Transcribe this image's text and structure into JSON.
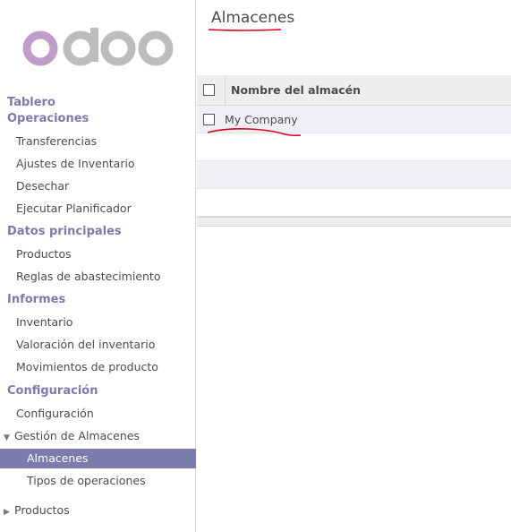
{
  "brand": {
    "logo_text": "odoo"
  },
  "sidebar": {
    "sections": [
      {
        "label": "Tablero",
        "items": []
      },
      {
        "label": "Operaciones",
        "items": [
          "Transferencias",
          "Ajustes de Inventario",
          "Desechar",
          "Ejecutar Planificador"
        ]
      },
      {
        "label": "Datos principales",
        "items": [
          "Productos",
          "Reglas de abastecimiento"
        ]
      },
      {
        "label": "Informes",
        "items": [
          "Inventario",
          "Valoración del inventario",
          "Movimientos de producto"
        ]
      },
      {
        "label": "Configuración",
        "items": [
          "Configuración",
          "Gestión de Almacenes",
          "Almacenes",
          "Tipos de operaciones",
          "Productos"
        ]
      }
    ]
  },
  "main": {
    "title": "Almacenes",
    "table": {
      "columns": [
        "Nombre del almacén"
      ],
      "rows": [
        "My Company"
      ]
    }
  },
  "colors": {
    "accent": "#7c7bad",
    "annotation": "#e0001a"
  }
}
